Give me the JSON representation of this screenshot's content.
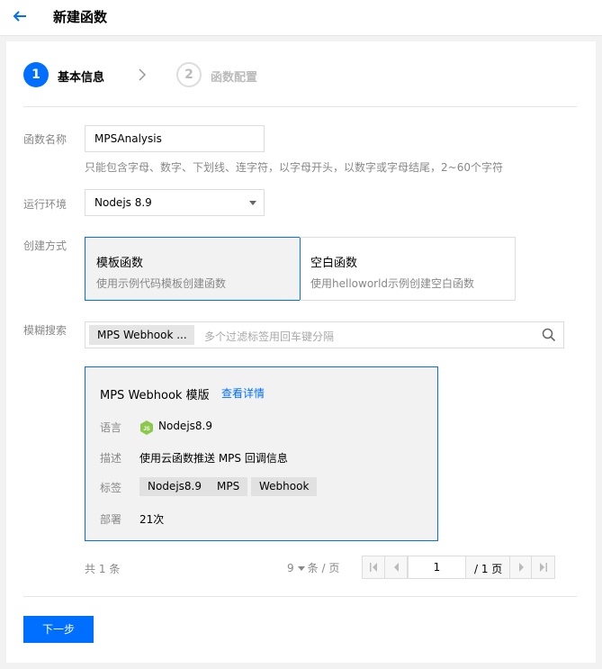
{
  "header": {
    "title": "新建函数",
    "back_icon": "arrow-left-icon"
  },
  "steps": [
    {
      "number": "1",
      "label": "基本信息",
      "active": true
    },
    {
      "number": "2",
      "label": "函数配置",
      "active": false
    }
  ],
  "form": {
    "name": {
      "label": "函数名称",
      "value": "MPSAnalysis",
      "hint": "只能包含字母、数字、下划线、连字符，以字母开头，以数字或字母结尾，2~60个字符"
    },
    "runtime": {
      "label": "运行环境",
      "value": "Nodejs 8.9"
    },
    "method": {
      "label": "创建方式",
      "options": [
        {
          "title": "模板函数",
          "desc": "使用示例代码模板创建函数",
          "selected": true
        },
        {
          "title": "空白函数",
          "desc": "使用helloworld示例创建空白函数",
          "selected": false
        }
      ]
    },
    "search": {
      "label": "模糊搜索",
      "tag": "MPS Webhook ...",
      "placeholder": "多个过滤标签用回车键分隔"
    }
  },
  "template_card": {
    "title": "MPS Webhook 模版",
    "link": "查看详情",
    "language_label": "语言",
    "language_value": "Nodejs8.9",
    "desc_label": "描述",
    "desc_value": "使用云函数推送 MPS 回调信息",
    "tags_label": "标签",
    "tags": [
      "Nodejs8.9",
      "MPS",
      "Webhook"
    ],
    "deploy_label": "部署",
    "deploy_value": "21次"
  },
  "pagination": {
    "total_prefix": "共",
    "total": "1",
    "total_suffix": "条",
    "page_size": "9",
    "page_size_unit": "条 / 页",
    "current_page": "1",
    "total_pages": "/ 1 页"
  },
  "actions": {
    "next_label": "下一步"
  },
  "colors": {
    "primary": "#006eff",
    "muted": "#888888",
    "node_green": "#8cc84b"
  }
}
